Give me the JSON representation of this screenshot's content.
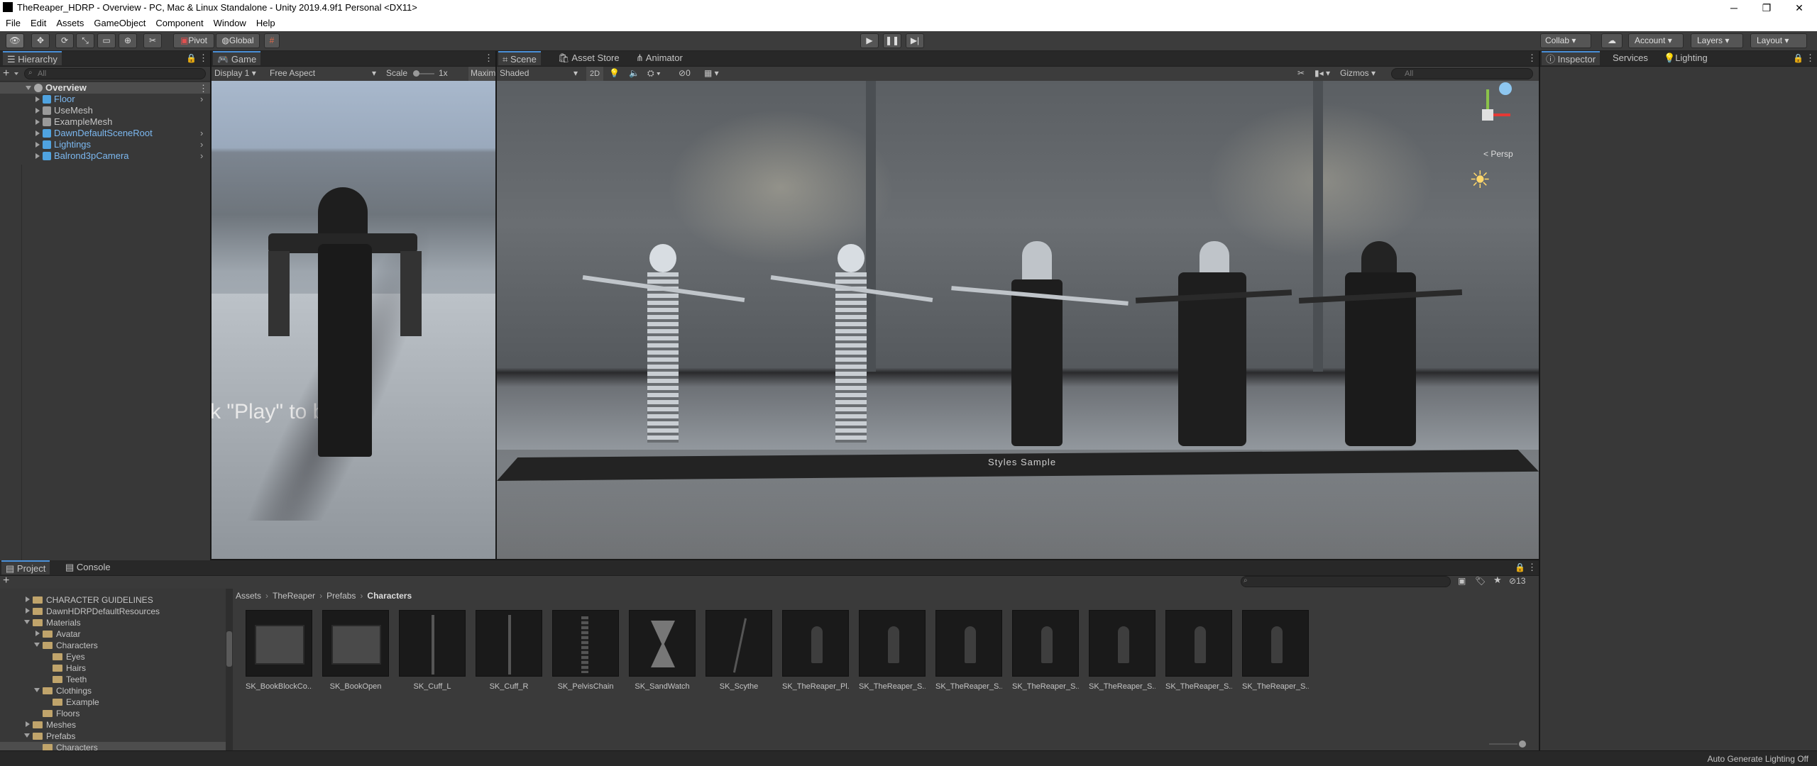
{
  "window": {
    "title": "TheReaper_HDRP - Overview - PC, Mac & Linux Standalone - Unity 2019.4.9f1 Personal <DX11>",
    "minimize": "─",
    "maximize": "❐",
    "close": "✕"
  },
  "menu": [
    "File",
    "Edit",
    "Assets",
    "GameObject",
    "Component",
    "Window",
    "Help"
  ],
  "toolbar": {
    "pivot": "Pivot",
    "global": "Global",
    "collab": "Collab",
    "account": "Account",
    "layers": "Layers",
    "layout": "Layout"
  },
  "hierarchy": {
    "tab": "Hierarchy",
    "search_placeholder": "All",
    "add": "+",
    "scene": "Overview",
    "items": [
      "Floor",
      "UseMesh",
      "ExampleMesh",
      "DawnDefaultSceneRoot",
      "Lightings",
      "Balrond3pCamera"
    ]
  },
  "game": {
    "tab": "Game",
    "display": "Display 1",
    "aspect": "Free Aspect",
    "scale_label": "Scale",
    "scale_value": "1x",
    "maximize": "Maxim",
    "overlay_text": "k \"Play\" to beg"
  },
  "scene": {
    "tabs": [
      "Scene",
      "Asset Store",
      "Animator"
    ],
    "shading": "Shaded",
    "mode2d": "2D",
    "hidden_count": "0",
    "gizmos": "Gizmos",
    "search_placeholder": "All",
    "persp": "< Persp",
    "banner": "Styles Sample"
  },
  "inspector": {
    "tabs": [
      "Inspector",
      "Services",
      "Lighting"
    ]
  },
  "project": {
    "tabs": [
      "Project",
      "Console"
    ],
    "add": "+",
    "count": "13",
    "breadcrumb": [
      "Assets",
      "TheReaper",
      "Prefabs",
      "Characters"
    ],
    "tree": [
      {
        "label": "CHARACTER GUIDELINES",
        "depth": 1
      },
      {
        "label": "DawnHDRPDefaultResources",
        "depth": 1
      },
      {
        "label": "Materials",
        "depth": 1
      },
      {
        "label": "Avatar",
        "depth": 2
      },
      {
        "label": "Characters",
        "depth": 2
      },
      {
        "label": "Eyes",
        "depth": 3
      },
      {
        "label": "Hairs",
        "depth": 3
      },
      {
        "label": "Teeth",
        "depth": 3
      },
      {
        "label": "Clothings",
        "depth": 2
      },
      {
        "label": "Example",
        "depth": 3
      },
      {
        "label": "Floors",
        "depth": 2
      },
      {
        "label": "Meshes",
        "depth": 1
      },
      {
        "label": "Prefabs",
        "depth": 1
      },
      {
        "label": "Characters",
        "depth": 2
      }
    ],
    "assets": [
      "SK_BookBlockCo...",
      "SK_BookOpen",
      "SK_Cuff_L",
      "SK_Cuff_R",
      "SK_PelvisChain",
      "SK_SandWatch",
      "SK_Scythe",
      "SK_TheReaper_Pl...",
      "SK_TheReaper_S...",
      "SK_TheReaper_S...",
      "SK_TheReaper_S...",
      "SK_TheReaper_S...",
      "SK_TheReaper_S...",
      "SK_TheReaper_S..."
    ]
  },
  "status": {
    "text": "Auto Generate Lighting Off"
  }
}
